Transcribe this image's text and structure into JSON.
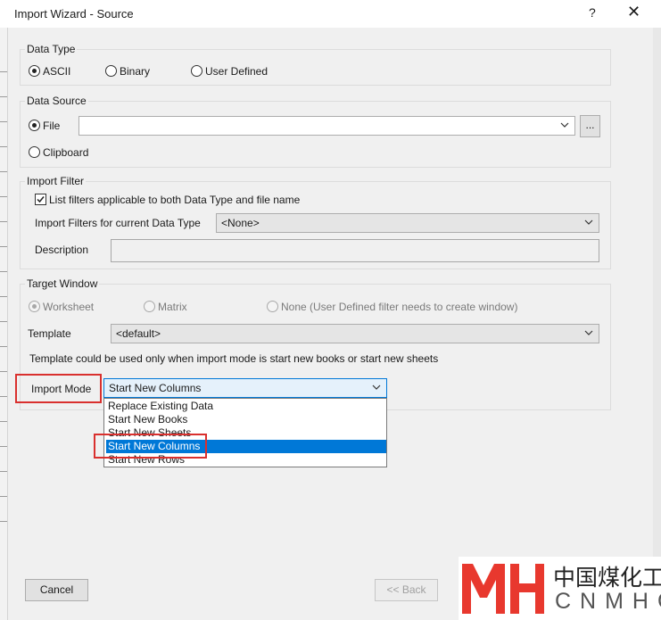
{
  "window": {
    "title": "Import Wizard - Source",
    "help_label": "?",
    "close_label": "✕"
  },
  "data_type": {
    "legend": "Data Type",
    "options": [
      {
        "label": "ASCII",
        "selected": true
      },
      {
        "label": "Binary",
        "selected": false
      },
      {
        "label": "User Defined",
        "selected": false
      }
    ]
  },
  "data_source": {
    "legend": "Data Source",
    "file_label": "File",
    "file_value": "",
    "browse_label": "...",
    "clipboard_label": "Clipboard"
  },
  "import_filter": {
    "legend": "Import Filter",
    "checkbox_label": "List filters applicable to both Data Type and file name",
    "checkbox_checked": true,
    "filters_label": "Import Filters for current Data Type",
    "filters_value": "<None>",
    "description_label": "Description",
    "description_value": ""
  },
  "target_window": {
    "legend": "Target Window",
    "options": [
      {
        "label": "Worksheet",
        "selected": true
      },
      {
        "label": "Matrix",
        "selected": false
      },
      {
        "label": "None (User Defined filter needs to create window)",
        "selected": false
      }
    ],
    "template_label": "Template",
    "template_value": "<default>",
    "note": "Template could be used only when import mode is start new books or start new sheets",
    "import_mode_label": "Import Mode",
    "import_mode_value": "Start New Columns",
    "import_mode_options": [
      "Replace Existing Data",
      "Start New Books",
      "Start New Sheets",
      "Start New Columns",
      "Start New Rows"
    ],
    "import_mode_selected_index": 3
  },
  "footer": {
    "cancel_label": "Cancel",
    "back_label": "<< Back"
  },
  "watermark": {
    "logo_letters": "MH",
    "cn_text": "中国煤化工",
    "en_text": "CNMHG"
  },
  "colors": {
    "highlight": "#0078d7",
    "annotation_red": "#d9302e",
    "watermark_red": "#e8382e"
  }
}
